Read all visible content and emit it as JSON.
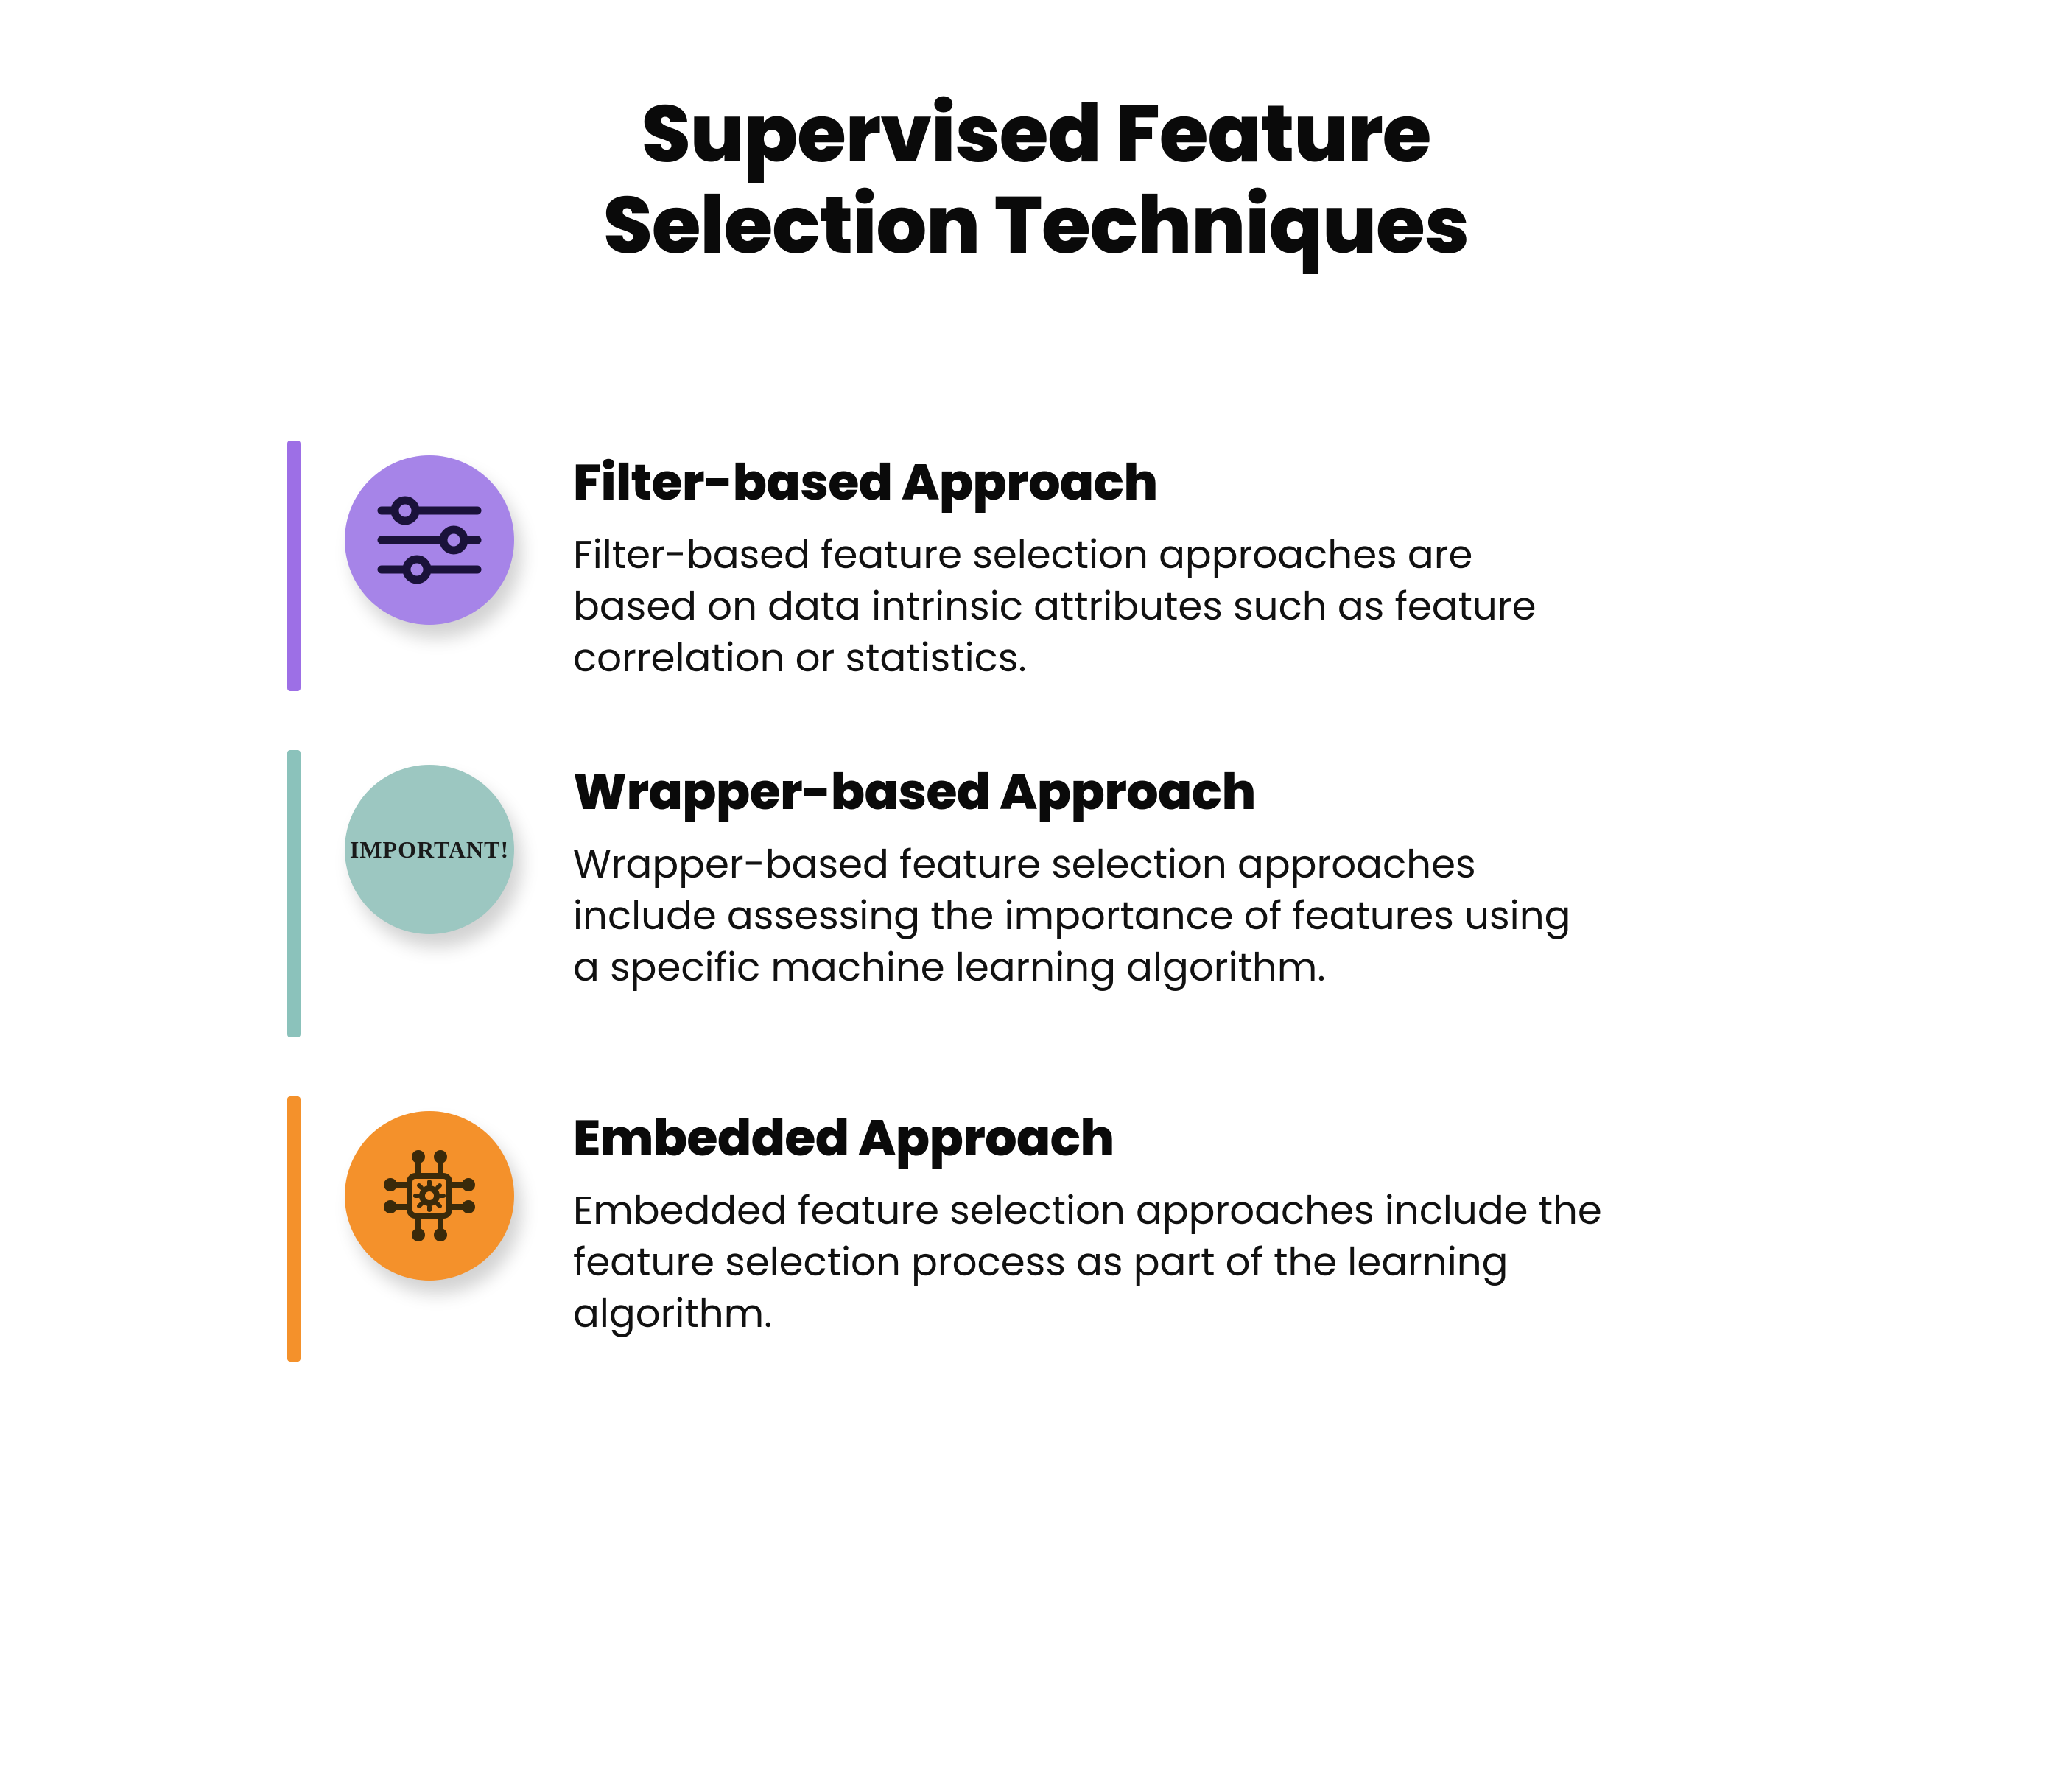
{
  "title_line1": "Supervised Feature",
  "title_line2": "Selection Techniques",
  "items": [
    {
      "title": "Filter-based Approach",
      "description": "Filter-based feature selection approaches are based on data intrinsic attributes such as feature correlation or statistics.",
      "icon": "sliders-icon",
      "color": "#9d6fe6"
    },
    {
      "title": "Wrapper-based Approach",
      "description": "Wrapper-based feature selection approaches include assessing the importance of features using a specific machine learning algorithm.",
      "icon": "important-stamp-icon",
      "icon_text": "IMPORTANT!",
      "color": "#8bc2bb"
    },
    {
      "title": "Embedded Approach",
      "description": "Embedded feature selection approaches include the feature selection process as part of the learning algorithm.",
      "icon": "chip-icon",
      "color": "#f4912b"
    }
  ]
}
